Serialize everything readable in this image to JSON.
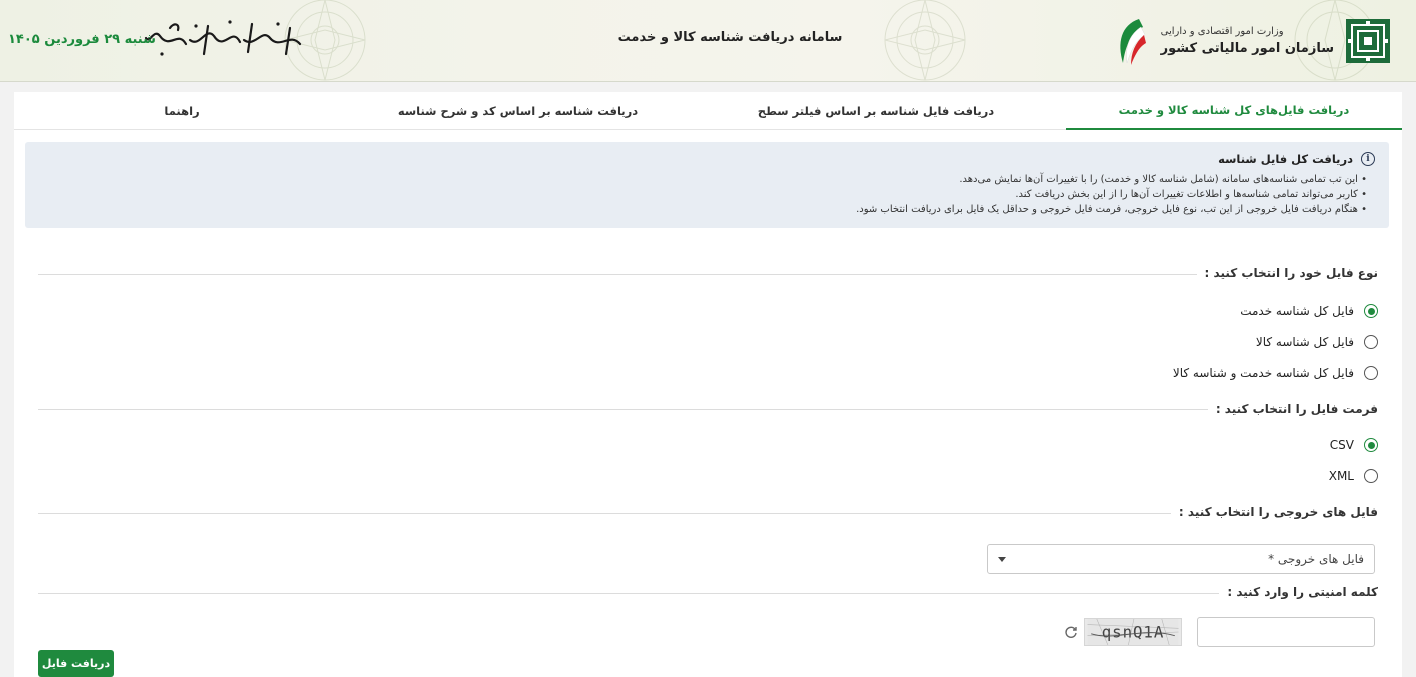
{
  "header": {
    "ministry": "وزارت امور اقتصادی و دارایی",
    "organization": "سازمان امور مالیاتی کشور",
    "title": "سامانه دریافت شناسه کالا و خدمت",
    "slogan": "اقتصاد مقاومتی در سایه وحدت ملی و امنیت ملی",
    "date": "شنبه ۲۹ فروردین ۱۴۰۵",
    "accent_color": "#1b8a3c"
  },
  "tabs": [
    {
      "label": "دریافت فایل‌های کل شناسه کالا و خدمت",
      "active": true
    },
    {
      "label": "دریافت فایل شناسه بر اساس فیلتر سطح",
      "active": false
    },
    {
      "label": "دریافت شناسه بر اساس کد و شرح شناسه",
      "active": false
    },
    {
      "label": "راهنما",
      "active": false
    }
  ],
  "info": {
    "icon": "info-icon",
    "title": "دریافت کل فایل شناسه",
    "items": [
      "این تب تمامی شناسه‌های سامانه (شامل شناسه کالا و خدمت) را با تغییرات آن‌ها نمایش می‌دهد.",
      "کاربر می‌تواند تمامی شناسه‌ها و اطلاعات تغییرات آن‌ها را از این بخش دریافت کند.",
      "هنگام دریافت فایل خروجی از این تب، نوع فایل خروجی، فرمت فایل خروجی و حداقل یک فایل برای دریافت انتخاب شود."
    ]
  },
  "file_type": {
    "label": "نوع فایل خود را انتخاب کنید :",
    "options": [
      {
        "label": "فایل کل شناسه خدمت",
        "checked": true
      },
      {
        "label": "فایل کل شناسه کالا",
        "checked": false
      },
      {
        "label": "فایل کل شناسه خدمت و شناسه کالا",
        "checked": false
      }
    ]
  },
  "file_format": {
    "label": "فرمت فایل را انتخاب کنید :",
    "options": [
      {
        "label": "CSV",
        "checked": true
      },
      {
        "label": "XML",
        "checked": false
      }
    ]
  },
  "output_files": {
    "label": "فایل های خروجی را انتخاب کنید :",
    "select_value": "فایل های خروجی *"
  },
  "captcha": {
    "label": "کلمه امنیتی را وارد کنید :",
    "input_value": "",
    "image_text": "qsnQ1A"
  },
  "submit_label": "دریافت فایل"
}
